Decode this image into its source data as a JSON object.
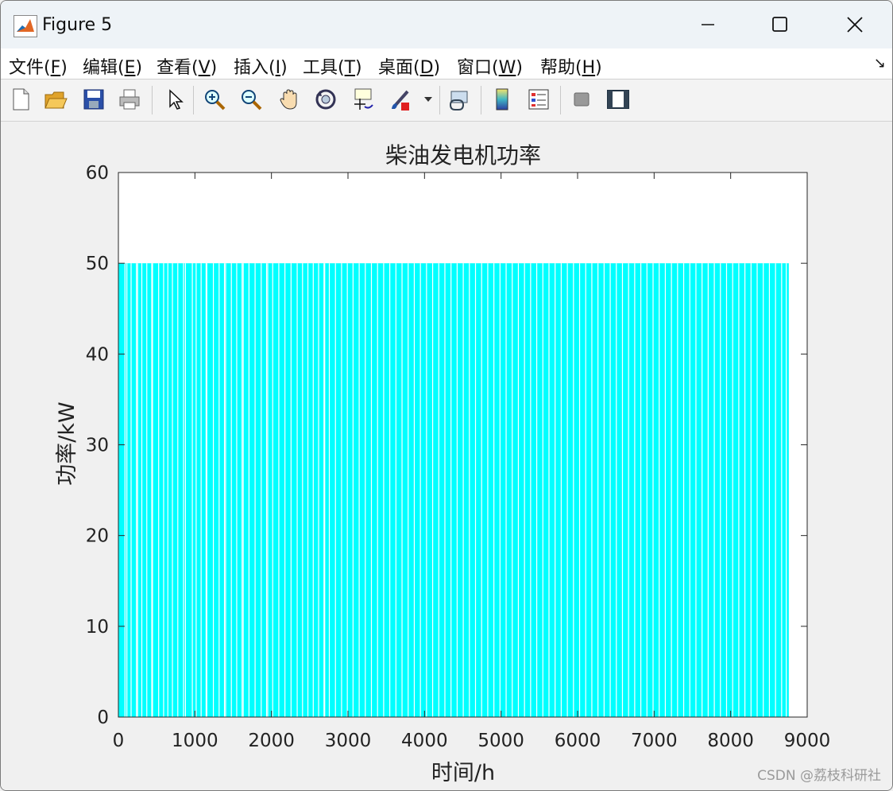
{
  "window": {
    "title": "Figure 5",
    "controls": [
      "minimize",
      "maximize",
      "close"
    ]
  },
  "menu": {
    "items": [
      {
        "label": "文件(F)",
        "text": "文件(",
        "key": "F",
        "end": ")"
      },
      {
        "label": "编辑(E)",
        "text": "编辑(",
        "key": "E",
        "end": ")"
      },
      {
        "label": "查看(V)",
        "text": "查看(",
        "key": "V",
        "end": ")"
      },
      {
        "label": "插入(I)",
        "text": "插入(",
        "key": "I",
        "end": ")"
      },
      {
        "label": "工具(T)",
        "text": "工具(",
        "key": "T",
        "end": ")"
      },
      {
        "label": "桌面(D)",
        "text": "桌面(",
        "key": "D",
        "end": ")"
      },
      {
        "label": "窗口(W)",
        "text": "窗口(",
        "key": "W",
        "end": ")"
      },
      {
        "label": "帮助(H)",
        "text": "帮助(",
        "key": "H",
        "end": ")"
      }
    ]
  },
  "toolbar": {
    "tools": [
      "new-figure-icon",
      "open-icon",
      "save-icon",
      "print-icon",
      "select-arrow-icon",
      "zoom-in-icon",
      "zoom-out-icon",
      "pan-hand-icon",
      "rotate-3d-icon",
      "data-cursor-icon",
      "brush-icon",
      "link-plot-icon",
      "colorbar-icon",
      "legend-icon",
      "hide-plot-tools-icon",
      "show-plot-tools-icon"
    ]
  },
  "chart_data": {
    "type": "bar",
    "title": "柴油发电机功率",
    "xlabel": "时间/h",
    "ylabel": "功率/kW",
    "xlim": [
      0,
      9000
    ],
    "ylim": [
      0,
      60
    ],
    "xticks": [
      0,
      1000,
      2000,
      3000,
      4000,
      5000,
      6000,
      7000,
      8000,
      9000
    ],
    "yticks": [
      0,
      10,
      20,
      30,
      40,
      50,
      60
    ],
    "series": [
      {
        "color": "#00ffff",
        "hours": 8760,
        "on_value": 50,
        "off_value": 0,
        "gap_hours": [
          80,
          105,
          160,
          230,
          245,
          300,
          365,
          430,
          440,
          520,
          585,
          640,
          700,
          770,
          845,
          870,
          960,
          1010,
          1075,
          1140,
          1150,
          1235,
          1310,
          1380,
          1395,
          1470,
          1540,
          1610,
          1625,
          1700,
          1780,
          1860,
          1930,
          1945,
          2010,
          2090,
          2170,
          2250,
          2330,
          2400,
          2470,
          2540,
          2610,
          2680,
          2690,
          2750,
          2830,
          2910,
          2985,
          3060,
          3140,
          3220,
          3300,
          3380,
          3460,
          3540,
          3620,
          3700,
          3780,
          3860,
          3940,
          4020,
          4100,
          4180,
          4260,
          4340,
          4420,
          4500,
          4580,
          4660,
          4740,
          4820,
          4900,
          4980,
          5060,
          5140,
          5220,
          5300,
          5380,
          5460,
          5540,
          5620,
          5700,
          5780,
          5860,
          5940,
          6020,
          6100,
          6180,
          6260,
          6340,
          6420,
          6500,
          6580,
          6660,
          6740,
          6820,
          6900,
          6980,
          7060,
          7140,
          7220,
          7300,
          7380,
          7460,
          7540,
          7620,
          7700,
          7780,
          7860,
          7940,
          8020,
          8100,
          8180,
          8260,
          8340,
          8420,
          8500,
          8580,
          8660,
          8720
        ]
      }
    ],
    "grid": false
  },
  "watermark": "CSDN @荔枝科研社"
}
